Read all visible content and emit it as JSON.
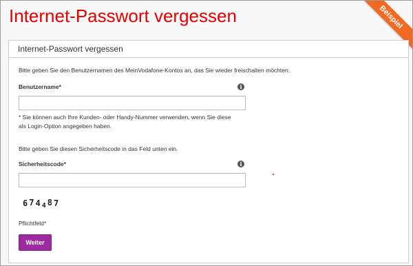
{
  "page": {
    "title": "Internet-Passwort vergessen",
    "ribbon": "Beispiel"
  },
  "card": {
    "header": "Internet-Passwort vergessen",
    "intro": "Bitte geben Sie den Benutzernamen des MeinVodafone-Kontos an, das Sie wieder freischalten möchten:",
    "username_label": "Benutzername*",
    "username_value": "",
    "username_hint_line1": "* Sie können auch Ihre Kunden- oder Handy-Nummer verwenden, wenn Sie diese",
    "username_hint_line2": "als Login-Option angegeben haben.",
    "security_intro": "Bitte geben Sie diesen Sicherheitscode in das Feld unten ein.",
    "security_label": "Sicherheitscode*",
    "security_value": "",
    "captcha_digits": [
      "6",
      "7",
      "4",
      "4",
      "8",
      "7"
    ],
    "required_note": "Pflichtfeld*",
    "submit_label": "Weiter",
    "info_glyph": "i"
  },
  "colors": {
    "brand_red": "#e60000",
    "ribbon_orange": "#f26a21",
    "button_purple": "#9c2aa0"
  },
  "icons": {
    "info": "info-icon"
  }
}
